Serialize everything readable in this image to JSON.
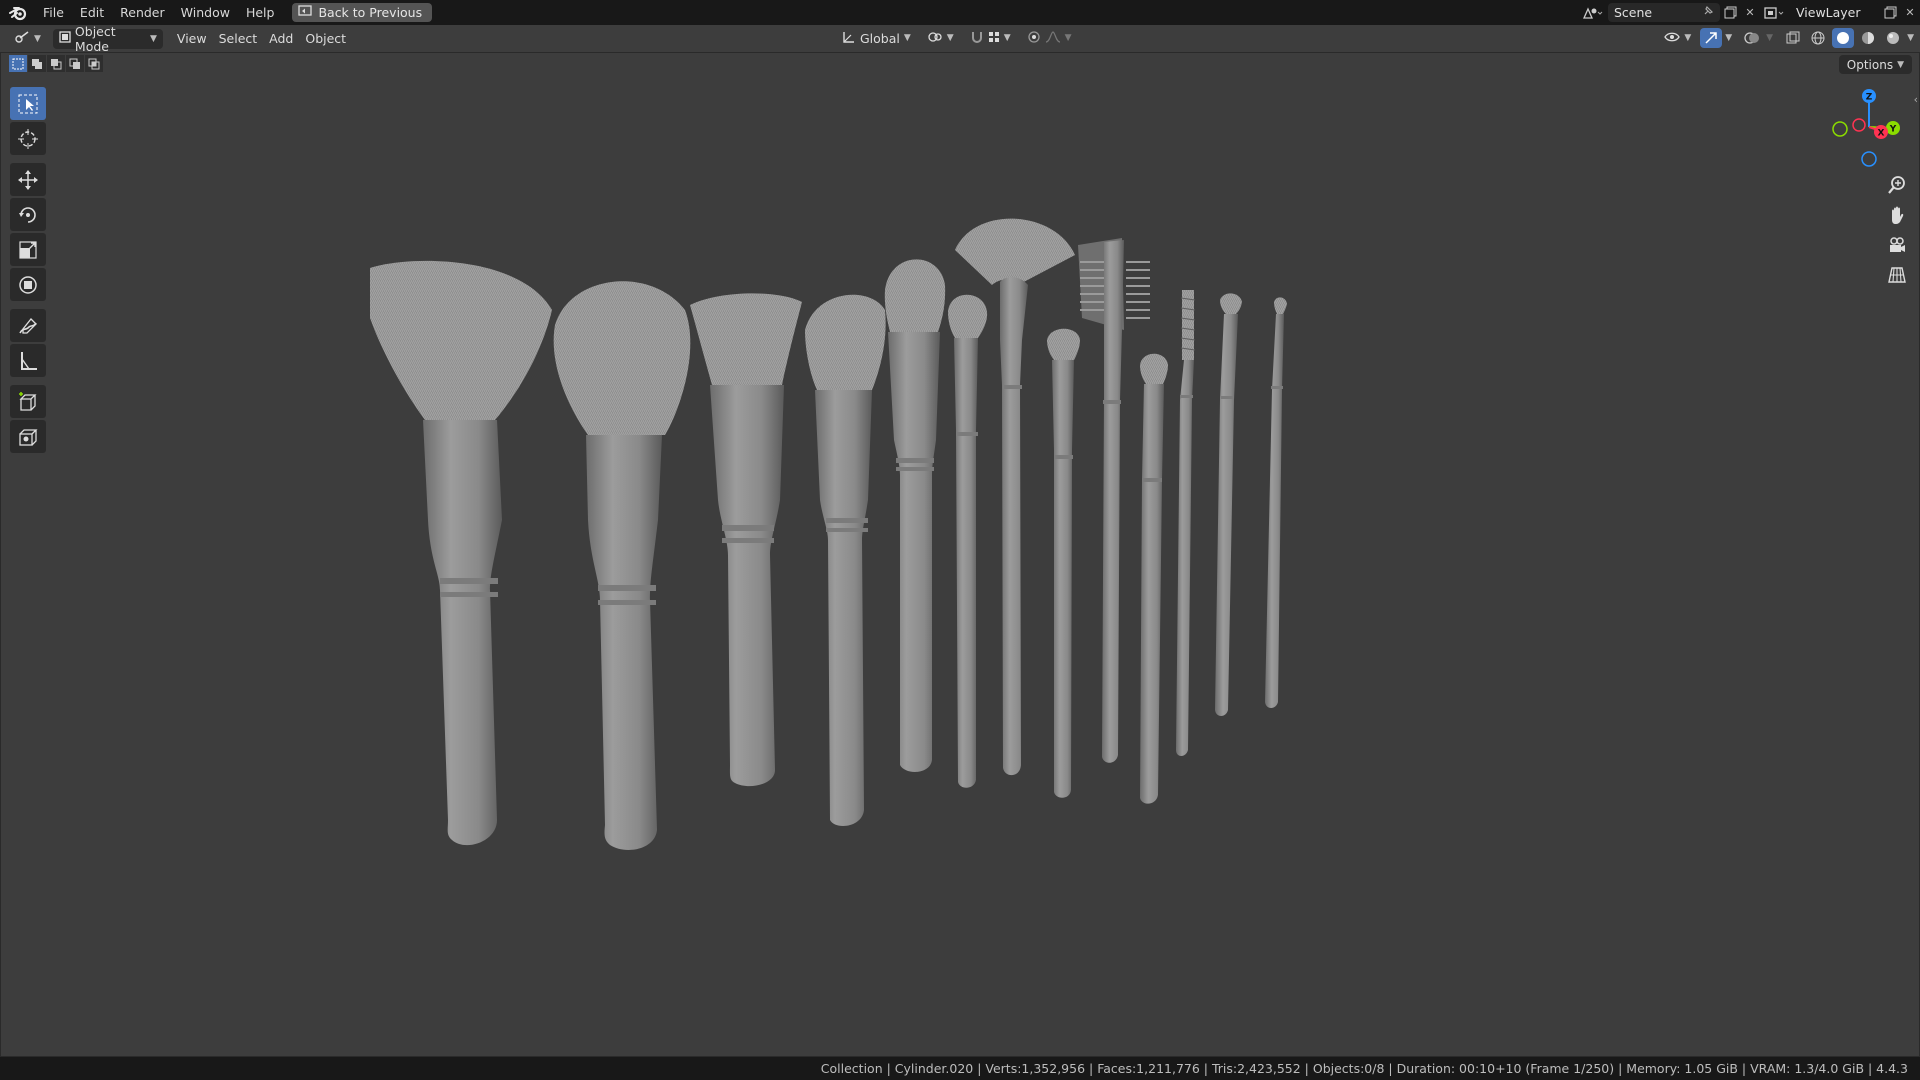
{
  "menu": {
    "items": [
      "File",
      "Edit",
      "Render",
      "Window",
      "Help"
    ],
    "back_button": "Back to Previous"
  },
  "top_right": {
    "scene_name": "Scene",
    "view_layer": "ViewLayer"
  },
  "header": {
    "mode": "Object Mode",
    "menus": [
      "View",
      "Select",
      "Add",
      "Object"
    ],
    "transform_orientation": "Global",
    "options_label": "Options"
  },
  "toolbar": {
    "tools": [
      "select-box",
      "cursor",
      "move",
      "rotate",
      "scale",
      "transform",
      "annotate",
      "measure",
      "add-cube",
      "add-object"
    ],
    "active_tool": "select-box"
  },
  "gizmo": {
    "z_label": "Z",
    "x_label": "X",
    "y_label": "Y"
  },
  "status": {
    "text": "Collection | Cylinder.020 | Verts:1,352,956 | Faces:1,211,776 | Tris:2,423,552 | Objects:0/8 | Duration: 00:10+10 (Frame 1/250) | Memory: 1.05 GiB | VRAM: 1.3/4.0 GiB | 4.4.3"
  },
  "colors": {
    "background": "#3d3d3d",
    "bar": "#181818",
    "accent": "#4772b3",
    "axis_x": "#ff3352",
    "axis_y": "#8bdc00",
    "axis_z": "#2890ff"
  }
}
